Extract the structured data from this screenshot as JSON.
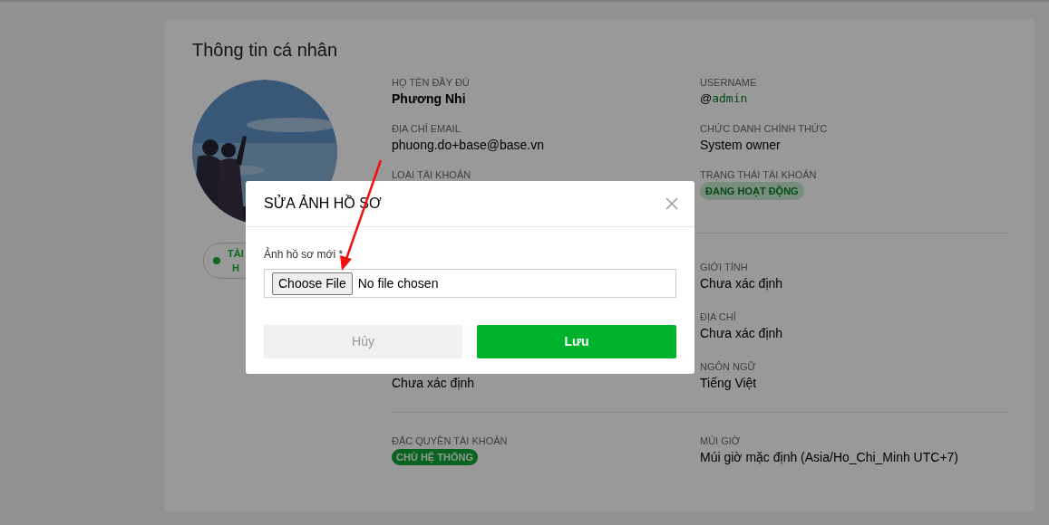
{
  "page": {
    "title": "Thông tin cá nhân",
    "status_pill": {
      "lines": [
        "TÀI",
        "H"
      ]
    },
    "section_1": [
      {
        "left": {
          "label": "HỌ TÊN ĐẦY ĐỦ",
          "value": "Phương Nhi",
          "kind": "bold"
        },
        "right": {
          "label": "USERNAME",
          "at": "@",
          "value": "admin",
          "kind": "username"
        }
      },
      {
        "left": {
          "label": "ĐỊA CHỈ EMAIL",
          "value": "phuong.do+base@base.vn",
          "kind": "text"
        },
        "right": {
          "label": "CHỨC DANH CHÍNH THỨC",
          "value": "System owner",
          "kind": "text"
        }
      },
      {
        "left": {
          "label": "LOẠI TÀI KHOẢN",
          "kind": "hidden"
        },
        "right": {
          "label": "TRẠNG THÁI TÀI KHOẢN",
          "value": "ĐANG HOẠT ĐỘNG",
          "kind": "soft-badge"
        }
      }
    ],
    "section_2": [
      {
        "right": {
          "label": "GIỚI TÍNH",
          "value": "Chưa xác định",
          "kind": "text"
        }
      },
      {
        "right": {
          "label": "ĐỊA CHỈ",
          "value": "Chưa xác định",
          "kind": "text"
        }
      },
      {
        "left": {
          "value": "Chưa xác định",
          "kind": "text"
        },
        "right": {
          "label": "NGÔN NGỮ",
          "value": "Tiếng Việt",
          "kind": "text"
        }
      }
    ],
    "section_3": [
      {
        "left": {
          "label": "ĐẶC QUYỀN TÀI KHOẢN",
          "value": "CHỦ HỆ THỐNG",
          "kind": "solid-badge"
        },
        "right": {
          "label": "MÚI GIỜ",
          "value": "Múi giờ mặc định (Asia/Ho_Chi_Minh UTC+7)",
          "kind": "text"
        }
      }
    ]
  },
  "dialog": {
    "title": "SỬA ẢNH HỒ SƠ",
    "field_label": "Ảnh hồ sơ mới *",
    "file_button": "Choose File",
    "file_status": "No file chosen",
    "cancel": "Hủy",
    "save": "Lưu"
  }
}
